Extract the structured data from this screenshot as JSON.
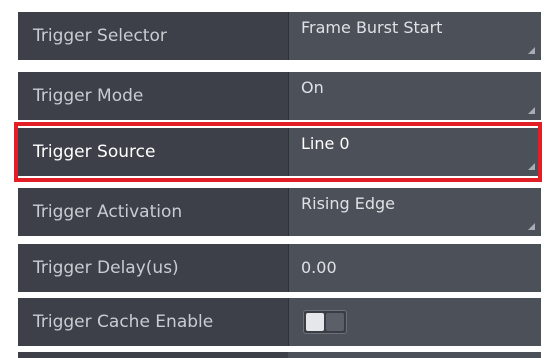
{
  "properties": [
    {
      "label": "Trigger Selector",
      "value": "Frame Burst Start",
      "control": "dropdown"
    },
    {
      "label": "Trigger Mode",
      "value": "On",
      "control": "dropdown"
    },
    {
      "label": "Trigger Source",
      "value": "Line 0",
      "control": "dropdown",
      "highlighted": true
    },
    {
      "label": "Trigger Activation",
      "value": "Rising Edge",
      "control": "dropdown"
    },
    {
      "label": "Trigger Delay(us)",
      "value": "0.00",
      "control": "number"
    },
    {
      "label": "Trigger Cache Enable",
      "value": false,
      "control": "toggle"
    }
  ],
  "colors": {
    "row_bg": "#3d4048",
    "value_bg": "#4c5058",
    "highlight_border": "#e31e24",
    "text": "#c9ccd1"
  }
}
